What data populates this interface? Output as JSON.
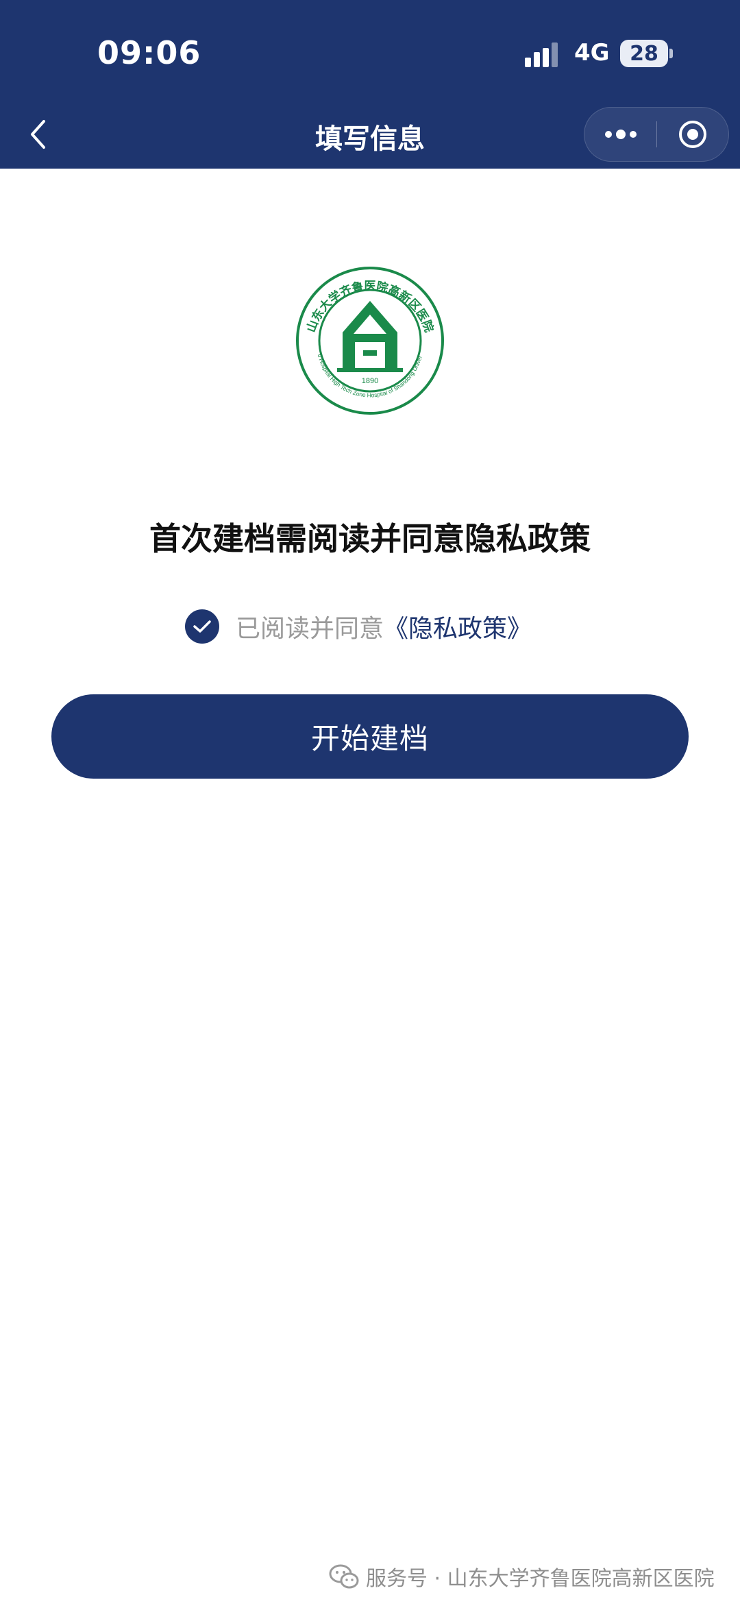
{
  "status_bar": {
    "time": "09:06",
    "network": "4G",
    "battery": "28"
  },
  "nav": {
    "title": "填写信息"
  },
  "logo": {
    "name_cn": "山东大学齐鲁医院高新区医院",
    "name_en": "Qilu Hospital High Tech Zone Hospital of Shandong University",
    "year": "1890",
    "color": "#1a8a4a"
  },
  "content": {
    "heading": "首次建档需阅读并同意隐私政策",
    "agree_text": "已阅读并同意",
    "policy_link": "《隐私政策》",
    "agree_checked": true,
    "start_button": "开始建档"
  },
  "footer": {
    "text": "服务号 · 山东大学齐鲁医院高新区医院"
  },
  "colors": {
    "primary": "#1e356f",
    "muted_text": "#9a9a9a",
    "heading_text": "#111111"
  }
}
